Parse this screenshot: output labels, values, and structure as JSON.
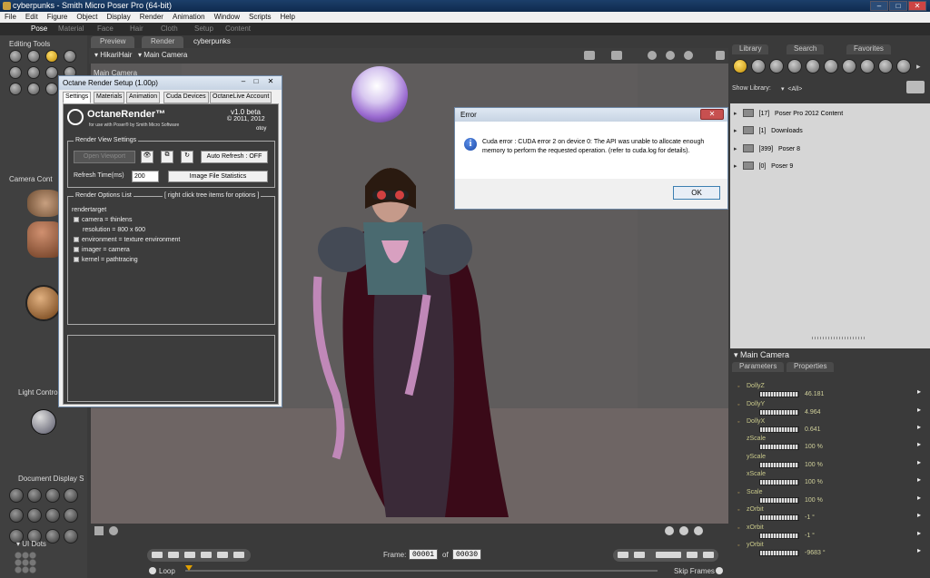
{
  "window": {
    "title": "cyberpunks - Smith Micro Poser Pro  (64-bit)",
    "controls": [
      "–",
      "□",
      "✕"
    ]
  },
  "menubar": [
    "File",
    "Edit",
    "Figure",
    "Object",
    "Display",
    "Render",
    "Animation",
    "Window",
    "Scripts",
    "Help"
  ],
  "rooms": [
    "Pose",
    "Material",
    "Face",
    "Hair",
    "Cloth",
    "Setup",
    "Content"
  ],
  "left_panel": {
    "editing_tools": "Editing Tools",
    "camera_controls": "Camera Cont",
    "light_controls": "Light Contro",
    "document_display": "Document Display S",
    "ui_dots": "UI Dots"
  },
  "viewport": {
    "tabs": [
      "Preview",
      "Render"
    ],
    "scene_tab": "cyberpunks",
    "figure_select": "HikariHair",
    "camera_select": "Main Camera",
    "camera_label": "Main Camera"
  },
  "octane": {
    "title": "Octane Render Setup (1.00p)",
    "tabs": [
      "Settings",
      "Materials",
      "Animation",
      "Cuda Devices",
      "OctaneLive Account"
    ],
    "logo": "OctaneRender™",
    "logo_sub": "for use with Poser® by Smith Micro Software",
    "version": "v1.0 beta",
    "copyright": "© 2011, 2012",
    "brand": "otoy",
    "render_view_settings": "Render View Settings",
    "open_viewport": "Open Viewport",
    "auto_refresh": "Auto Refresh : OFF",
    "refresh_time_label": "Refresh Time(ms)",
    "refresh_time_value": "200",
    "image_file_stats": "Image File Statistics",
    "render_options_list": "Render Options List",
    "right_click_hint": "[ right click tree items for options ]",
    "tree_root": "rendertarget",
    "tree": [
      {
        "label": "camera = thinlens",
        "expandable": true
      },
      {
        "label": "resolution = 800 x 600",
        "expandable": false
      },
      {
        "label": "environment = texture environment",
        "expandable": true
      },
      {
        "label": "imager = camera",
        "expandable": true
      },
      {
        "label": "kernel = pathtracing",
        "expandable": true
      }
    ],
    "controls": [
      "–",
      "□",
      "✕"
    ]
  },
  "error_dialog": {
    "title": "Error",
    "close": "✕",
    "icon": "i",
    "message": "Cuda error : CUDA error 2 on device 0: The API was unable to allocate enough memory to perform the requested operation. (refer to cuda.log for details).",
    "ok_label": "OK"
  },
  "library": {
    "tabs": [
      "Library",
      "Search",
      "Favorites"
    ],
    "show_library_label": "Show Library:",
    "show_library_value": "<All>",
    "items": [
      {
        "count": "[17]",
        "name": "Poser Pro 2012 Content"
      },
      {
        "count": "[1]",
        "name": "Downloads"
      },
      {
        "count": "[399]",
        "name": "Poser 8"
      },
      {
        "count": "[0]",
        "name": "Poser 9"
      }
    ]
  },
  "parameters": {
    "title": "Main Camera",
    "tabs": [
      "Parameters",
      "Properties"
    ],
    "rows": [
      {
        "name": "DollyZ",
        "value": "46.181"
      },
      {
        "name": "DollyY",
        "value": "4.964"
      },
      {
        "name": "DollyX",
        "value": "0.641"
      },
      {
        "name": "zScale",
        "value": "100 %"
      },
      {
        "name": "yScale",
        "value": "100 %"
      },
      {
        "name": "xScale",
        "value": "100 %"
      },
      {
        "name": "Scale",
        "value": "100 %"
      },
      {
        "name": "zOrbit",
        "value": "-1 °"
      },
      {
        "name": "xOrbit",
        "value": "-1 °"
      },
      {
        "name": "yOrbit",
        "value": "-9683 °"
      }
    ]
  },
  "timeline": {
    "frame_label": "Frame:",
    "current_frame": "00001",
    "of_label": "of",
    "total_frames": "00030",
    "loop_label": "Loop",
    "skip_frames_label": "Skip Frames"
  },
  "colors": {
    "titlebar": "#1c3f6a",
    "panel_bg": "#3a3a3a",
    "dialog_bg": "#f0f0f0",
    "accent_yellow": "#e0a800"
  }
}
